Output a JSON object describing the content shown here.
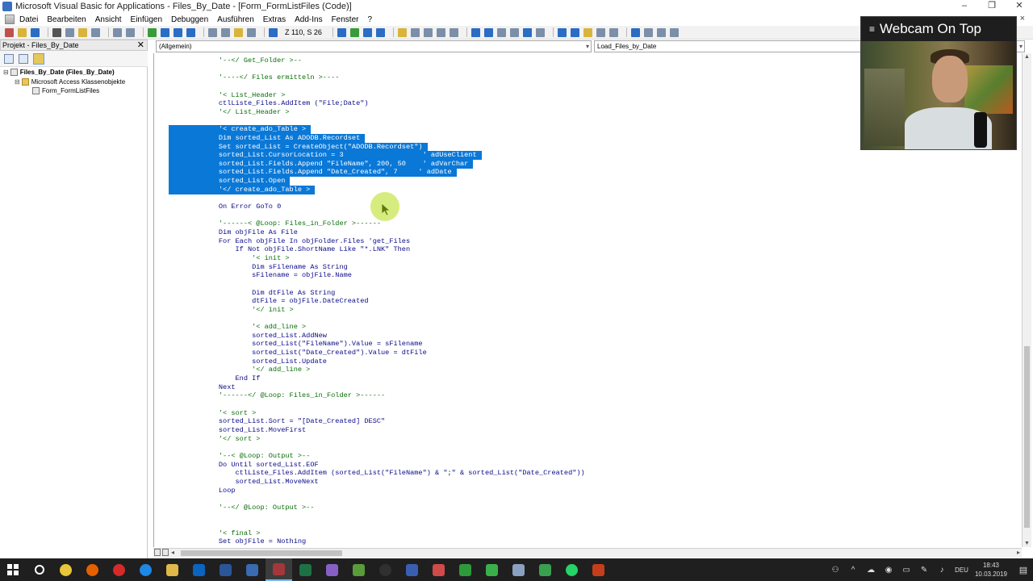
{
  "window": {
    "title": "Microsoft Visual Basic for Applications - Files_By_Date - [Form_FormListFiles (Code)]",
    "controls": [
      "–",
      "❐",
      "✕"
    ]
  },
  "menubar": {
    "items": [
      "Datei",
      "Bearbeiten",
      "Ansicht",
      "Einfügen",
      "Debuggen",
      "Ausführen",
      "Extras",
      "Add-Ins",
      "Fenster",
      "?"
    ],
    "close": "×"
  },
  "toolbar": {
    "cursor_position": "Z 110, S 26"
  },
  "project": {
    "title": "Projekt - Files_By_Date",
    "close": "✕",
    "tree": {
      "root": "Files_By_Date (Files_By_Date)",
      "group": "Microsoft Access Klassenobjekte",
      "item": "Form_FormListFiles"
    }
  },
  "code": {
    "object_combo": "(Allgemein)",
    "proc_combo": "Load_Files_by_Date",
    "lines": [
      {
        "t": "            '--</ Get_Folder >--",
        "k": "c"
      },
      {
        "t": "",
        "k": ""
      },
      {
        "t": "            '----</ Files ermitteln >----",
        "k": "c"
      },
      {
        "t": "",
        "k": ""
      },
      {
        "t": "            '< List_Header >",
        "k": "c"
      },
      {
        "t": "            ctlListe_Files.AddItem (\"File;Date\")",
        "k": ""
      },
      {
        "t": "            '</ List_Header >",
        "k": "c"
      },
      {
        "t": "",
        "k": ""
      },
      {
        "t": "            '< create_ado_Table >",
        "k": "h"
      },
      {
        "t": "            Dim sorted_List As ADODB.Recordset",
        "k": "h"
      },
      {
        "t": "            Set sorted_List = CreateObject(\"ADODB.Recordset\")",
        "k": "h"
      },
      {
        "t": "            sorted_List.CursorLocation = 3                   ' adUseClient",
        "k": "h"
      },
      {
        "t": "            sorted_List.Fields.Append \"FileName\", 200, 50    ' adVarChar",
        "k": "h"
      },
      {
        "t": "            sorted_List.Fields.Append \"Date_Created\", 7     ' adDate",
        "k": "h"
      },
      {
        "t": "            sorted_List.Open",
        "k": "h"
      },
      {
        "t": "            '</ create_ado_Table >",
        "k": "h"
      },
      {
        "t": "",
        "k": ""
      },
      {
        "t": "            On Error GoTo 0",
        "k": ""
      },
      {
        "t": "",
        "k": ""
      },
      {
        "t": "            '------< @Loop: Files_in_Folder >------",
        "k": "c"
      },
      {
        "t": "            Dim objFile As File",
        "k": ""
      },
      {
        "t": "            For Each objFile In objFolder.Files 'get_Files",
        "k": ""
      },
      {
        "t": "                If Not objFile.ShortName Like \"*.LNK\" Then",
        "k": ""
      },
      {
        "t": "                    '< init >",
        "k": "c"
      },
      {
        "t": "                    Dim sFilename As String",
        "k": ""
      },
      {
        "t": "                    sFilename = objFile.Name",
        "k": ""
      },
      {
        "t": "",
        "k": ""
      },
      {
        "t": "                    Dim dtFile As String",
        "k": ""
      },
      {
        "t": "                    dtFile = objFile.DateCreated",
        "k": ""
      },
      {
        "t": "                    '</ init >",
        "k": "c"
      },
      {
        "t": "",
        "k": ""
      },
      {
        "t": "                    '< add_line >",
        "k": "c"
      },
      {
        "t": "                    sorted_List.AddNew",
        "k": ""
      },
      {
        "t": "                    sorted_List(\"FileName\").Value = sFilename",
        "k": ""
      },
      {
        "t": "                    sorted_List(\"Date_Created\").Value = dtFile",
        "k": ""
      },
      {
        "t": "                    sorted_List.Update",
        "k": ""
      },
      {
        "t": "                    '</ add_line >",
        "k": "c"
      },
      {
        "t": "                End If",
        "k": ""
      },
      {
        "t": "            Next",
        "k": ""
      },
      {
        "t": "            '------</ @Loop: Files_in_Folder >------",
        "k": "c"
      },
      {
        "t": "",
        "k": ""
      },
      {
        "t": "            '< sort >",
        "k": "c"
      },
      {
        "t": "            sorted_List.Sort = \"[Date_Created] DESC\"",
        "k": ""
      },
      {
        "t": "            sorted_List.MoveFirst",
        "k": ""
      },
      {
        "t": "            '</ sort >",
        "k": "c"
      },
      {
        "t": "",
        "k": ""
      },
      {
        "t": "            '--< @Loop: Output >--",
        "k": "c"
      },
      {
        "t": "            Do Until sorted_List.EOF",
        "k": ""
      },
      {
        "t": "                ctlListe_Files.AddItem (sorted_List(\"FileName\") & \";\" & sorted_List(\"Date_Created\"))",
        "k": ""
      },
      {
        "t": "                sorted_List.MoveNext",
        "k": ""
      },
      {
        "t": "            Loop",
        "k": ""
      },
      {
        "t": "",
        "k": ""
      },
      {
        "t": "            '--</ @Loop: Output >--",
        "k": "c"
      },
      {
        "t": "",
        "k": ""
      },
      {
        "t": "",
        "k": ""
      },
      {
        "t": "            '< final >",
        "k": "c"
      },
      {
        "t": "            Set objFile = Nothing",
        "k": ""
      }
    ]
  },
  "webcam": {
    "title": "Webcam On Top",
    "menu": "≡"
  },
  "taskbar": {
    "apps": [
      "search",
      "chrome",
      "firefox",
      "opera",
      "edge",
      "explorer",
      "outlook",
      "word",
      "powershell",
      "access",
      "excel",
      "visual-studio",
      "app-green",
      "obs",
      "app-blue",
      "app-red",
      "app-green2",
      "app-green3",
      "app-image",
      "app-green4",
      "whatsapp",
      "powerpoint"
    ],
    "app_colors": [
      "#ffffff",
      "#e8c53a",
      "#e66000",
      "#d42a2a",
      "#1e88e5",
      "#e0b84a",
      "#0a64c0",
      "#2a5699",
      "#3a6ab0",
      "#a4373a",
      "#1e7145",
      "#865fc5",
      "#5a9b3a",
      "#303030",
      "#3a5fb0",
      "#d04a4a",
      "#2e9b3a",
      "#3ab04a",
      "#8aa0c0",
      "#3aa050",
      "#25d366",
      "#c43e1c"
    ],
    "active_app": "access",
    "language": "DEU",
    "time": "18:43",
    "date": "10.03.2019"
  }
}
